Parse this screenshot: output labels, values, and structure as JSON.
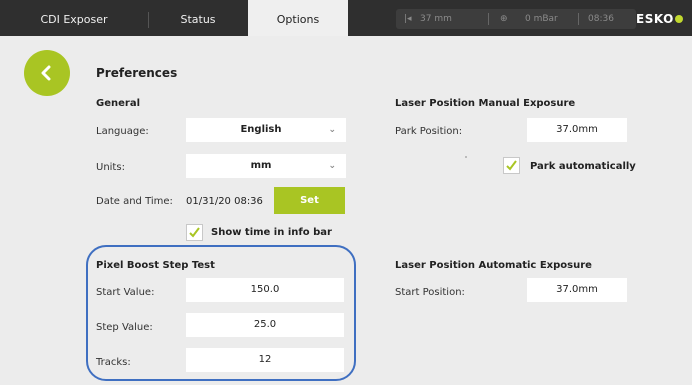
{
  "tabs": [
    {
      "label": "CDI Exposer"
    },
    {
      "label": "Status"
    },
    {
      "label": "Options"
    }
  ],
  "infobar": {
    "position": "37 mm",
    "pressure": "0 mBar",
    "time": "08:36"
  },
  "brand": {
    "name": "ESKO"
  },
  "page": {
    "title": "Preferences"
  },
  "general": {
    "heading": "General",
    "language_label": "Language:",
    "language_value": "English",
    "units_label": "Units:",
    "units_value": "mm",
    "datetime_label": "Date and Time:",
    "datetime_value": "01/31/20 08:36",
    "set_label": "Set",
    "show_time_label": "Show time in info bar",
    "show_time_checked": true
  },
  "pixel_boost": {
    "heading": "Pixel Boost Step Test",
    "start_label": "Start Value:",
    "start_value": "150.0",
    "step_label": "Step Value:",
    "step_value": "25.0",
    "tracks_label": "Tracks:",
    "tracks_value": "12"
  },
  "laser_manual": {
    "heading": "Laser Position Manual Exposure",
    "park_label": "Park Position:",
    "park_value": "37.0mm",
    "park_auto_label": "Park automatically",
    "park_auto_checked": true
  },
  "laser_auto": {
    "heading": "Laser Position Automatic Exposure",
    "start_label": "Start Position:",
    "start_value": "37.0mm"
  },
  "colors": {
    "accent": "#a9c523",
    "topbar": "#2f2f2f",
    "highlight": "#3f6fc1"
  }
}
